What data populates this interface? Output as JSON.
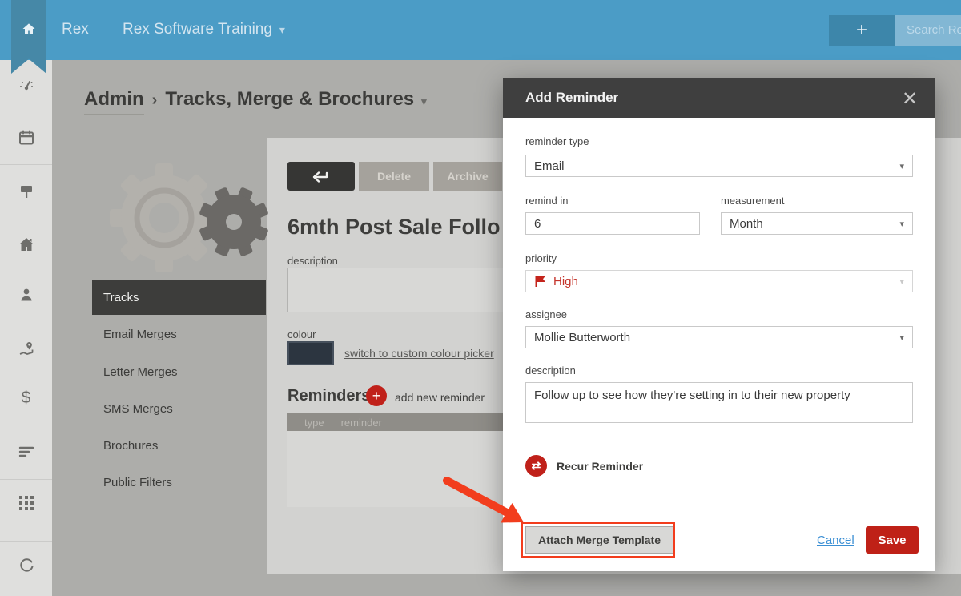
{
  "header": {
    "brand": "Rex",
    "workspace": "Rex Software Training",
    "search_text": "Search Re"
  },
  "breadcrumb": {
    "section": "Admin",
    "separator": "›",
    "page": "Tracks, Merge & Brochures"
  },
  "admin_menu": {
    "items": [
      {
        "label": "Tracks",
        "selected": true
      },
      {
        "label": "Email Merges",
        "selected": false
      },
      {
        "label": "Letter Merges",
        "selected": false
      },
      {
        "label": "SMS Merges",
        "selected": false
      },
      {
        "label": "Brochures",
        "selected": false
      },
      {
        "label": "Public Filters",
        "selected": false
      }
    ]
  },
  "editor": {
    "delete_label": "Delete",
    "archive_label": "Archive",
    "title": "6mth Post Sale Follo",
    "description_label": "description",
    "colour_label": "colour",
    "colour_link": "switch to custom colour picker",
    "reminders_heading": "Reminders",
    "add_reminder_label": "add new reminder",
    "table_headers": {
      "type": "type",
      "reminder": "reminder"
    }
  },
  "modal": {
    "title": "Add Reminder",
    "fields": {
      "reminder_type": {
        "label": "reminder type",
        "value": "Email"
      },
      "remind_in": {
        "label": "remind in",
        "value": "6"
      },
      "measurement": {
        "label": "measurement",
        "value": "Month"
      },
      "priority": {
        "label": "priority",
        "value": "High"
      },
      "assignee": {
        "label": "assignee",
        "value": "Mollie Butterworth"
      },
      "description": {
        "label": "description",
        "value": "Follow up to see how they're setting in to their new property"
      }
    },
    "recur_label": "Recur Reminder",
    "attach_button": "Attach Merge Template",
    "cancel_label": "Cancel",
    "save_label": "Save"
  },
  "icons": {
    "chevron_down": "▾",
    "plus": "+",
    "close": "✕",
    "dollar": "$",
    "recur": "⇄"
  },
  "colors": {
    "topbar_blue": "#4b9cc6",
    "accent_red": "#bf2117",
    "annotation_red": "#f23d1d",
    "colour_swatch": "#2c3540",
    "link_blue": "#3b8fd4",
    "modal_header": "#3f3f3f"
  }
}
